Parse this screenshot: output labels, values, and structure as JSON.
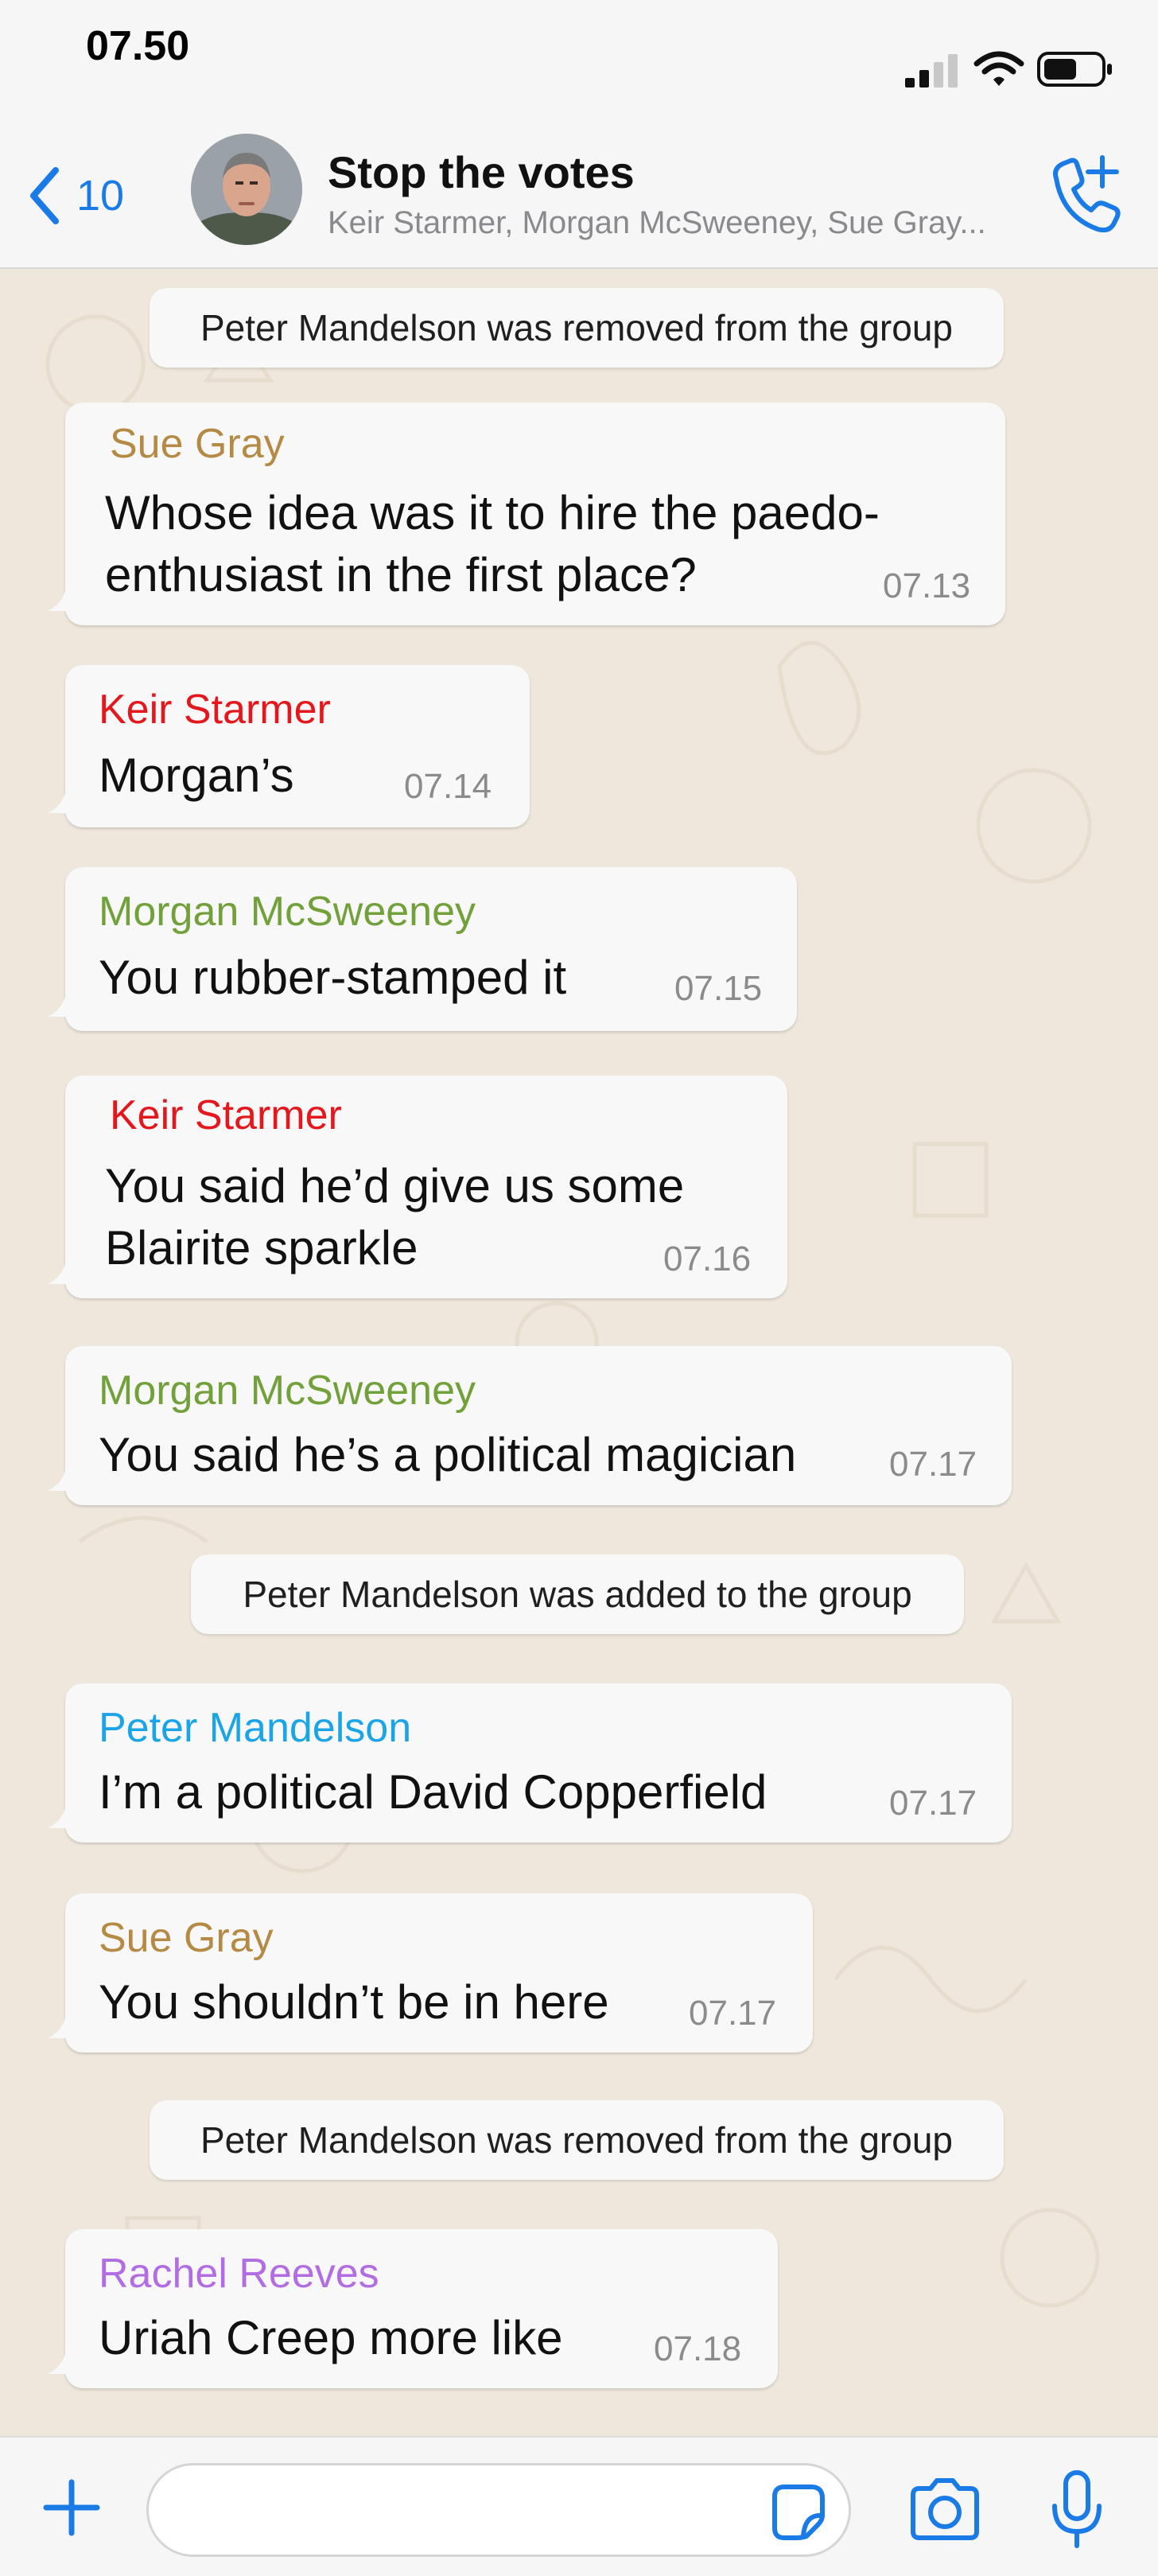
{
  "status_bar": {
    "time": "07.50"
  },
  "header": {
    "back_count": "10",
    "title": "Stop the votes",
    "subtitle": "Keir Starmer, Morgan McSweeney, Sue Gray..."
  },
  "colors": {
    "accent": "#1a7ae6",
    "sue_gray": "#b58a45",
    "keir_starmer": "#e3171c",
    "morgan_mcsweeney": "#72a03a",
    "peter_mandelson": "#1ba5e6",
    "rachel_reeves": "#b26de2"
  },
  "messages": [
    {
      "kind": "system",
      "text": "Peter Mandelson was removed from the group"
    },
    {
      "kind": "message",
      "sender": "Sue Gray",
      "lines": [
        "Whose idea was it to hire the paedo-",
        "enthusiast in the first place?"
      ],
      "time": "07.13"
    },
    {
      "kind": "message",
      "sender": "Keir Starmer",
      "lines": [
        "Morgan’s"
      ],
      "time": "07.14"
    },
    {
      "kind": "message",
      "sender": "Morgan McSweeney",
      "lines": [
        "You rubber-stamped it"
      ],
      "time": "07.15"
    },
    {
      "kind": "message",
      "sender": "Keir Starmer",
      "lines": [
        "You said he’d give us some",
        "Blairite sparkle"
      ],
      "time": "07.16"
    },
    {
      "kind": "message",
      "sender": "Morgan McSweeney",
      "lines": [
        "You said he’s a political magician"
      ],
      "time": "07.17"
    },
    {
      "kind": "system",
      "text": "Peter Mandelson was added to the group"
    },
    {
      "kind": "message",
      "sender": "Peter Mandelson",
      "lines": [
        "I’m a political David Copperfield"
      ],
      "time": "07.17"
    },
    {
      "kind": "message",
      "sender": "Sue Gray",
      "lines": [
        "You shouldn’t be in here"
      ],
      "time": "07.17"
    },
    {
      "kind": "system",
      "text": "Peter Mandelson was removed from the group"
    },
    {
      "kind": "message",
      "sender": "Rachel Reeves",
      "lines": [
        "Uriah Creep more like"
      ],
      "time": "07.18"
    }
  ],
  "icons": {
    "back": "chevron-left-icon",
    "call": "add-call-icon",
    "plus": "plus-icon",
    "sticker": "sticker-icon",
    "camera": "camera-icon",
    "mic": "microphone-icon"
  }
}
